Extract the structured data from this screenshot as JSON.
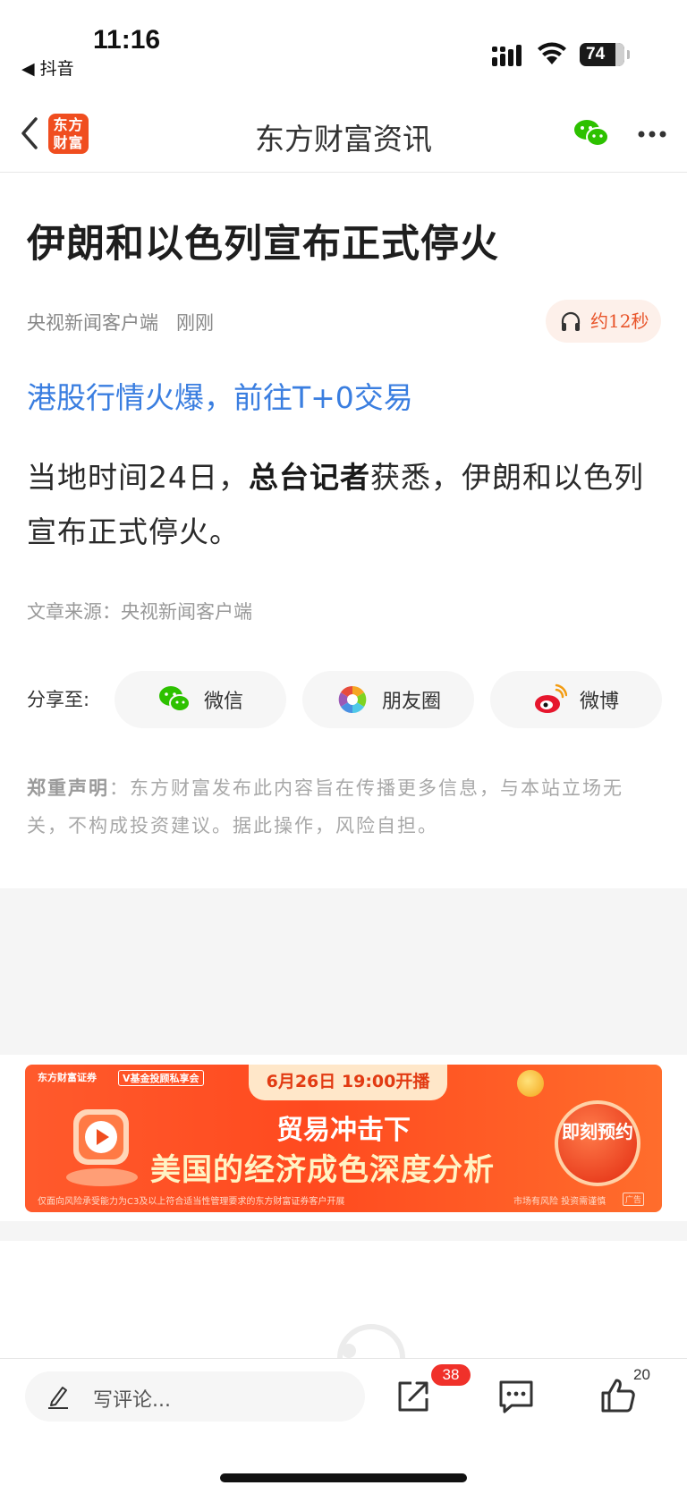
{
  "status_bar": {
    "time": "11:16",
    "back_app": "◀ 抖音",
    "battery": "74"
  },
  "nav": {
    "logo_line1": "东方",
    "logo_line2": "财富",
    "title": "东方财富资讯"
  },
  "article": {
    "title": "伊朗和以色列宣布正式停火",
    "source_name": "央视新闻客户端",
    "time_label": "刚刚",
    "audio_duration": "约12秒",
    "promo_link": "港股行情火爆，前往T+0交易",
    "body_part1": "当地时间24日，",
    "body_bold": "总台记者",
    "body_part2": "获悉，伊朗和以色列宣布正式停火。",
    "source_line": "文章来源：央视新闻客户端"
  },
  "share": {
    "label": "分享至:",
    "buttons": [
      {
        "label": "微信",
        "icon": "wechat-icon"
      },
      {
        "label": "朋友圈",
        "icon": "moments-icon"
      },
      {
        "label": "微博",
        "icon": "weibo-icon"
      }
    ]
  },
  "disclaimer": {
    "heading": "郑重声明",
    "text": "：东方财富发布此内容旨在传播更多信息，与本站立场无关，不构成投资建议。据此操作，风险自担。"
  },
  "banner": {
    "brand": "东方财富证券",
    "brand2": "V基金投顾私享会",
    "top_tag": "6月26日 19:00开播",
    "line1": "贸易冲击下",
    "line2": "美国的经济成色深度分析",
    "cta": "即刻预约",
    "note_left": "仅面向风险承受能力为C3及以上符合适当性管理要求的东方财富证券客户开展",
    "note_right": "市场有风险 投资需谨慎",
    "ad_tag": "广告"
  },
  "bottom_bar": {
    "comment_placeholder": "写评论...",
    "share_badge": "38",
    "like_count": "20"
  },
  "colors": {
    "accent_orange": "#f04d1f",
    "link_blue": "#3a7ee0",
    "badge_red": "#f0312a"
  }
}
